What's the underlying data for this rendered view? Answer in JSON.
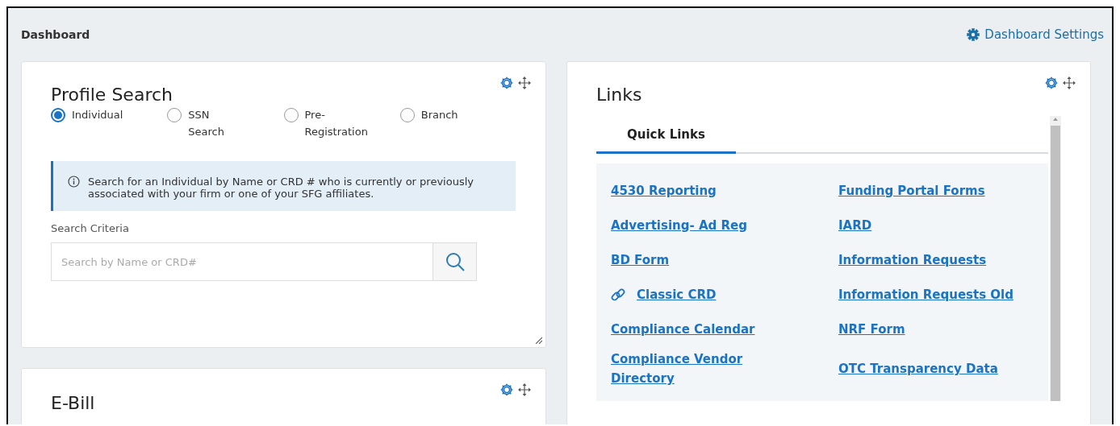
{
  "header": {
    "title": "Dashboard",
    "settings_link": "Dashboard Settings"
  },
  "profile_search": {
    "title": "Profile Search",
    "options": [
      {
        "label": "Individual",
        "selected": true
      },
      {
        "label": "SSN Search",
        "selected": false
      },
      {
        "label": "Pre-Registration",
        "selected": false
      },
      {
        "label": "Branch",
        "selected": false
      }
    ],
    "info": "Search for an Individual by Name or CRD # who is currently or previously associated with your firm or one of your SFG affiliates.",
    "field_label": "Search Criteria",
    "placeholder": "Search by Name or CRD#"
  },
  "ebill": {
    "title": "E-Bill"
  },
  "links": {
    "title": "Links",
    "tabs": [
      {
        "label": "Quick Links",
        "selected": true
      }
    ],
    "columns": [
      [
        {
          "label": "4530 Reporting",
          "kind": "plain"
        },
        {
          "label": "Advertising- Ad Reg",
          "kind": "plain"
        },
        {
          "label": "BD Form",
          "kind": "plain"
        },
        {
          "label": "Classic CRD",
          "kind": "chain"
        },
        {
          "label": "Compliance Calendar",
          "kind": "plain"
        },
        {
          "label": "Compliance Vendor Directory",
          "kind": "plain"
        }
      ],
      [
        {
          "label": "Funding Portal Forms",
          "kind": "plain"
        },
        {
          "label": "IARD",
          "kind": "plain"
        },
        {
          "label": "Information Requests",
          "kind": "plain"
        },
        {
          "label": "Information Requests Old",
          "kind": "plain"
        },
        {
          "label": "NRF Form",
          "kind": "plain"
        },
        {
          "label": "OTC Transparency Data",
          "kind": "plain"
        }
      ]
    ]
  }
}
